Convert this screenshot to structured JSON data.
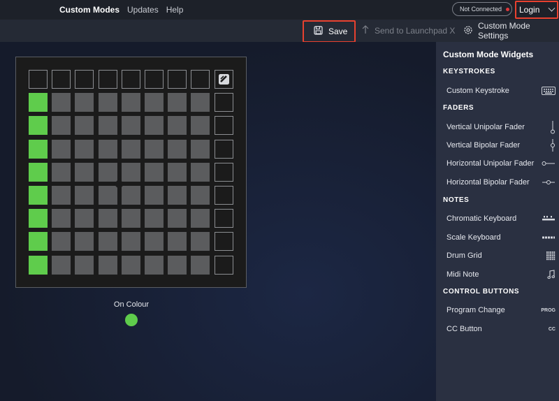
{
  "nav": {
    "items": [
      "Custom Modes",
      "Updates",
      "Help"
    ]
  },
  "connection": {
    "status": "Not Connected",
    "status_color": "#e0383b"
  },
  "login": {
    "label": "Login"
  },
  "toolbar": {
    "save_label": "Save",
    "send_label": "Send to Launchpad X",
    "settings_label": "Custom Mode Settings"
  },
  "pad_colors": {
    "on": "#5fcc4c",
    "off": "#5b5c5e"
  },
  "on_colour": {
    "label": "On Colour",
    "color": "#5fcc4c"
  },
  "panel": {
    "title": "Custom Mode Widgets",
    "sections": [
      {
        "title": "KEYSTROKES",
        "items": [
          {
            "label": "Custom Keystroke",
            "icon": "keyboard-icon"
          }
        ]
      },
      {
        "title": "FADERS",
        "items": [
          {
            "label": "Vertical Unipolar Fader",
            "icon": "vertical-unipolar-fader-icon"
          },
          {
            "label": "Vertical Bipolar Fader",
            "icon": "vertical-bipolar-fader-icon"
          },
          {
            "label": "Horizontal Unipolar Fader",
            "icon": "horizontal-unipolar-fader-icon"
          },
          {
            "label": "Horizontal Bipolar Fader",
            "icon": "horizontal-bipolar-fader-icon"
          }
        ]
      },
      {
        "title": "NOTES",
        "items": [
          {
            "label": "Chromatic Keyboard",
            "icon": "chromatic-keyboard-icon"
          },
          {
            "label": "Scale Keyboard",
            "icon": "scale-keyboard-icon"
          },
          {
            "label": "Drum Grid",
            "icon": "drum-grid-icon"
          },
          {
            "label": "Midi Note",
            "icon": "music-note-icon"
          }
        ]
      },
      {
        "title": "CONTROL BUTTONS",
        "items": [
          {
            "label": "Program Change",
            "icon": "prog-icon",
            "icon_text": "PROG"
          },
          {
            "label": "CC Button",
            "icon": "cc-icon",
            "icon_text": "CC"
          }
        ]
      }
    ]
  }
}
